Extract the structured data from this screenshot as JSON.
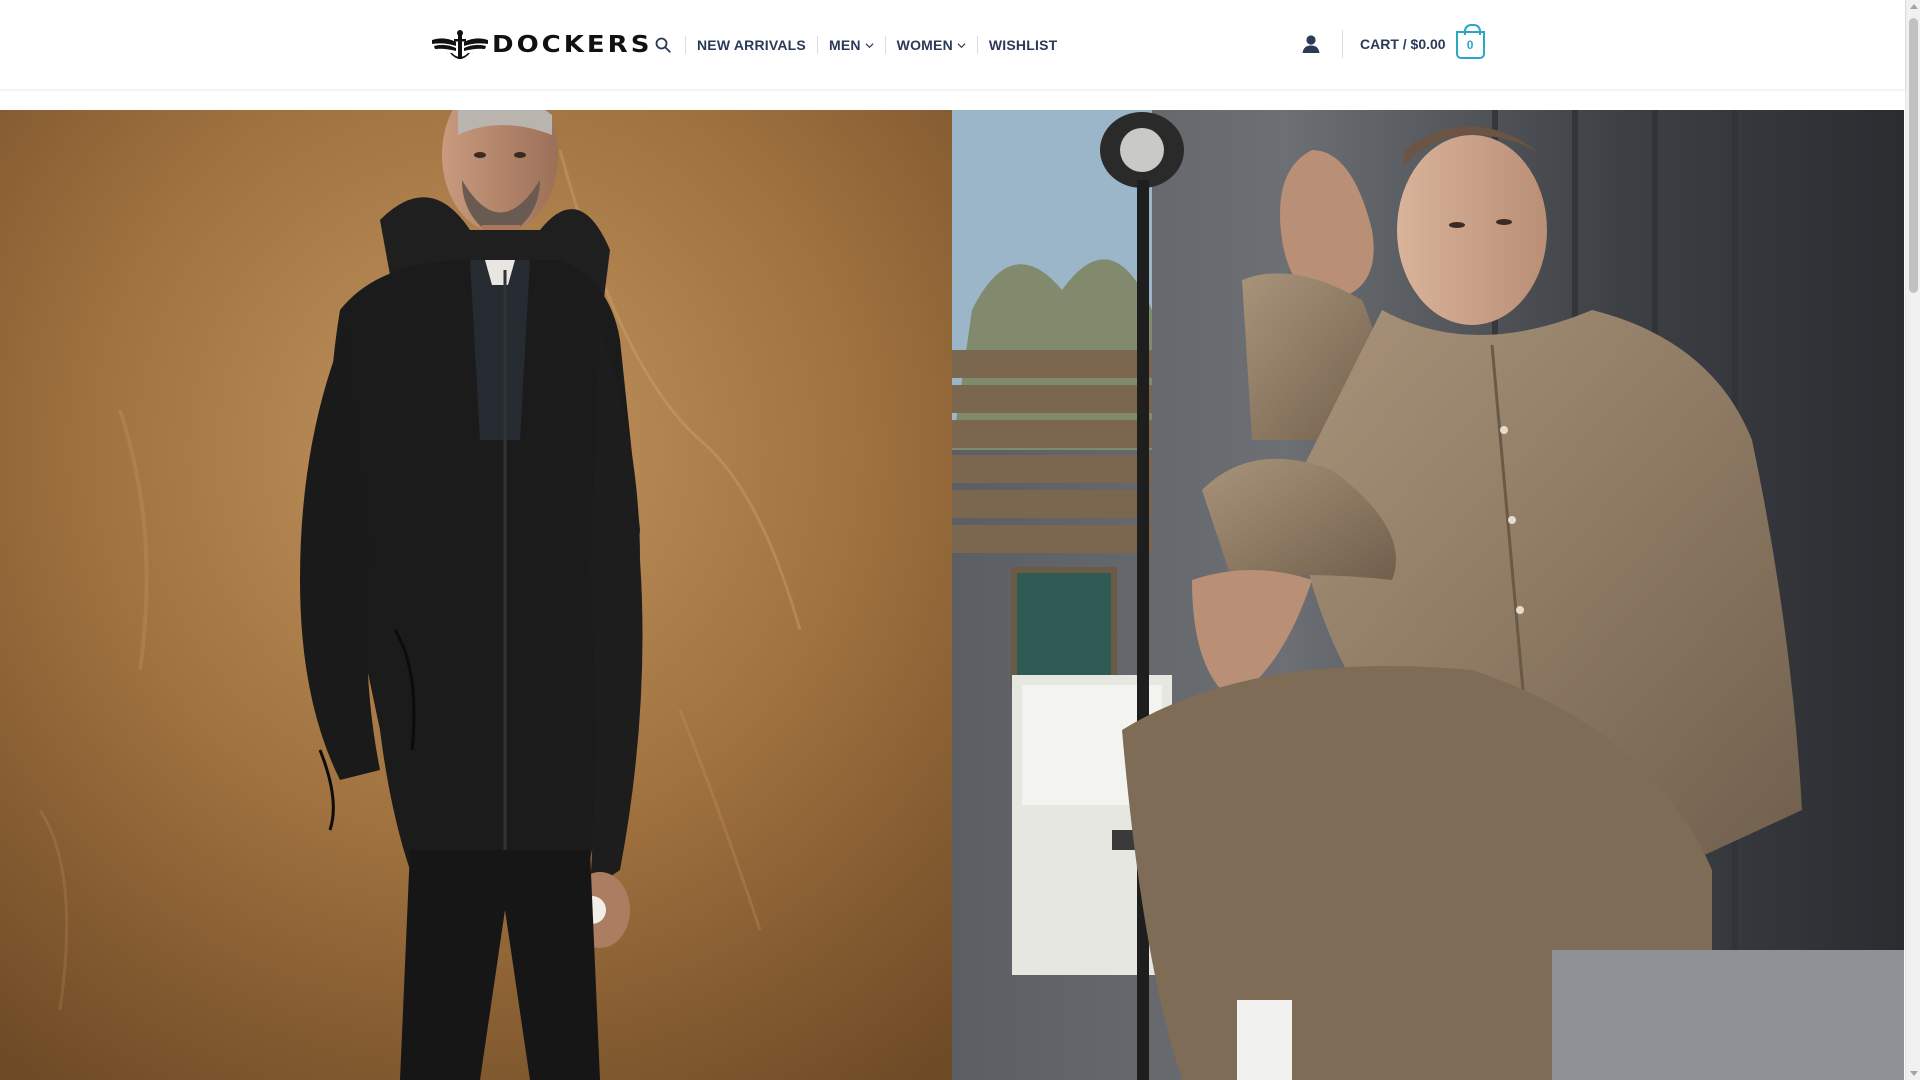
{
  "brand": {
    "logo_text": "DOCKERS",
    "logo_icon": "wings-anchor-logo"
  },
  "nav": {
    "search_icon": "search-icon",
    "items": [
      {
        "label": "NEW ARRIVALS",
        "has_dropdown": false
      },
      {
        "label": "MEN",
        "has_dropdown": true
      },
      {
        "label": "WOMEN",
        "has_dropdown": true
      },
      {
        "label": "WISHLIST",
        "has_dropdown": false
      }
    ]
  },
  "header_right": {
    "account_icon": "user-icon",
    "cart_label": "CART / $0.00",
    "cart_count": "0"
  },
  "hero": {
    "panels": [
      {
        "subject": "man-in-black-jacket"
      },
      {
        "subject": "man-in-khaki-shirt"
      }
    ]
  },
  "colors": {
    "nav_text": "#2b3a57",
    "accent": "#2aa7c7",
    "left_panel_bg": "#9c6f3f",
    "right_panel_bg": "#4a4e55"
  }
}
